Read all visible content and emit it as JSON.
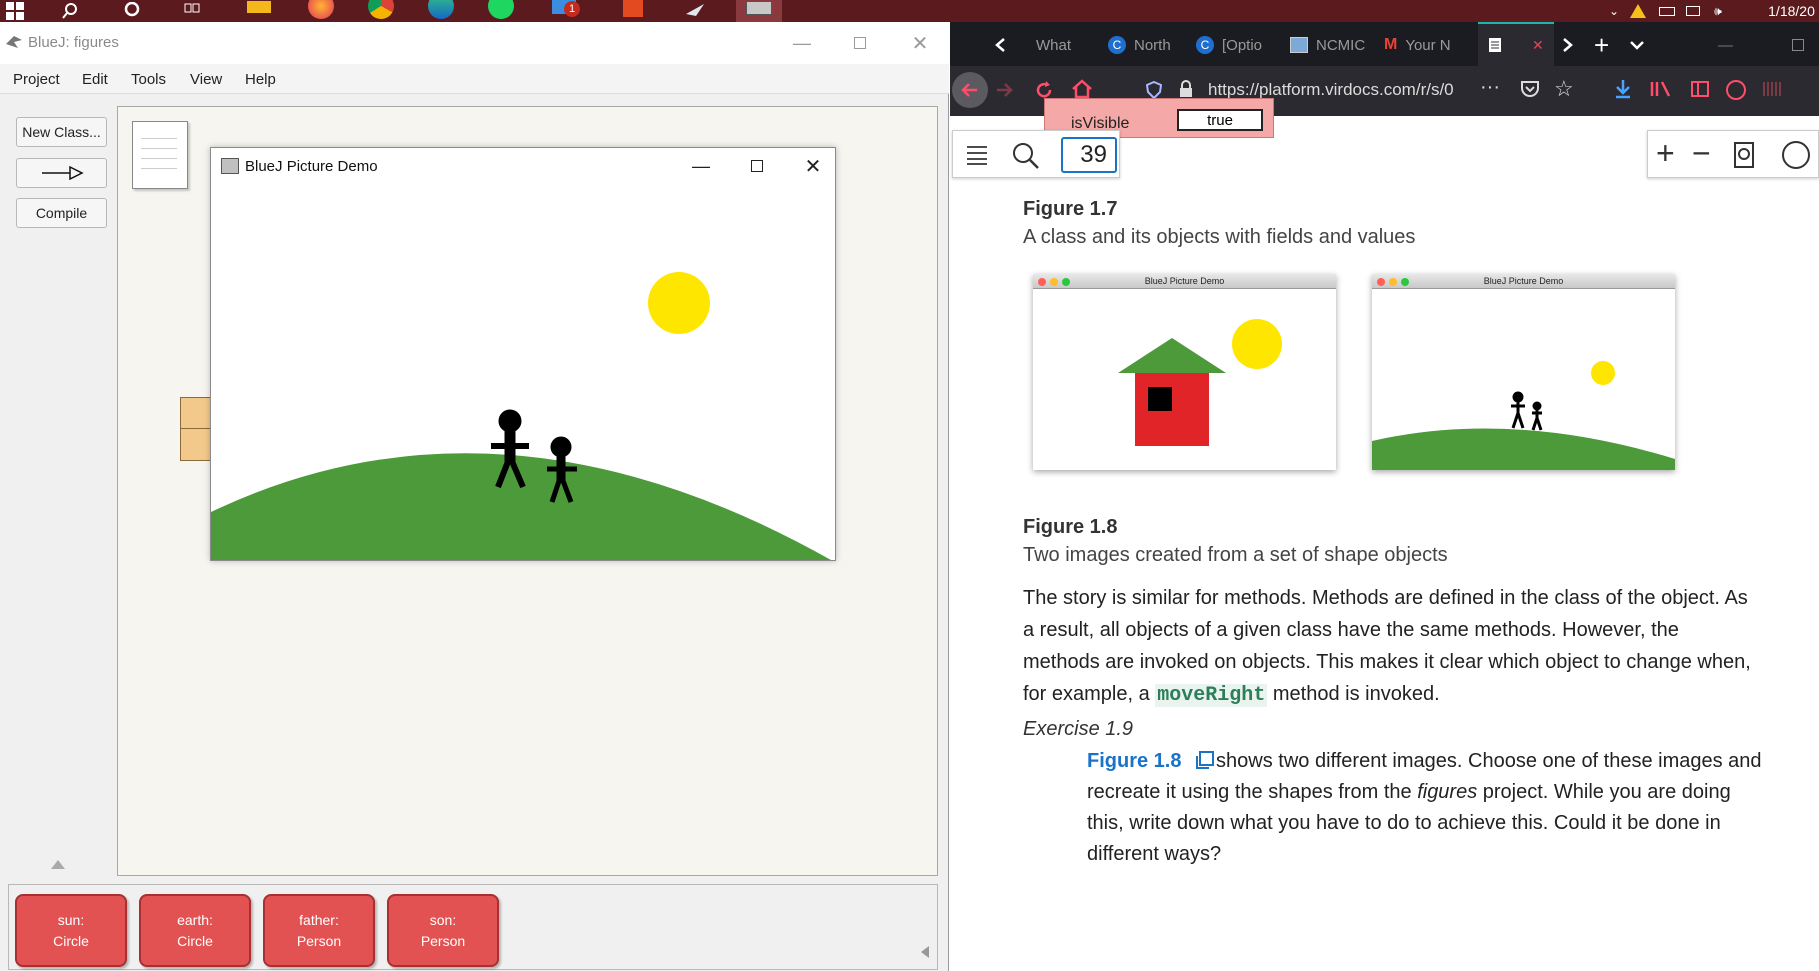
{
  "taskbar": {
    "date": "1/18/20",
    "mail_badge": "1"
  },
  "bluej": {
    "title": "BlueJ:  figures",
    "menu": [
      "Project",
      "Edit",
      "Tools",
      "View",
      "Help"
    ],
    "buttons": {
      "new_class": "New Class...",
      "compile": "Compile"
    },
    "objects": [
      {
        "name": "sun:",
        "type": "Circle"
      },
      {
        "name": "earth:",
        "type": "Circle"
      },
      {
        "name": "father:",
        "type": "Person"
      },
      {
        "name": "son:",
        "type": "Person"
      }
    ],
    "demo_window": {
      "title": "BlueJ Picture Demo"
    }
  },
  "firefox": {
    "tabs": [
      "What",
      "North",
      "[Optio",
      "NCMIC",
      "Your N"
    ],
    "url": "https://platform.virdocs.com/r/s/0",
    "reader": {
      "page_number": "39",
      "snippet_field": "isVisible",
      "snippet_value": "true"
    },
    "figure_1_7": {
      "label": "Figure 1.7",
      "caption": "A class and its objects with fields and values"
    },
    "mini_windows": [
      "BlueJ Picture Demo",
      "BlueJ Picture Demo"
    ],
    "figure_1_8": {
      "label": "Figure 1.8",
      "caption": "Two images created from a set of shape objects"
    },
    "paragraph": {
      "line1": "The story is similar for methods. Methods are defined in the class of the object. As",
      "line2": "a result, all objects of a given class have the same methods. However, the",
      "line3": "methods are invoked on objects. This makes it clear which object to change when,",
      "line4_pre": "for example, a ",
      "line4_code": "moveRight",
      "line4_post": " method is invoked."
    },
    "exercise": {
      "heading": "Exercise 1.9",
      "link": "Figure 1.8",
      "line1_post": "shows two different images. Choose one of these images and",
      "line2_pre": "recreate it using the shapes from the ",
      "line2_em": "figures",
      "line2_post": " project. While you are doing",
      "line3": "this, write down what you have to do to achieve this. Could it be done in",
      "line4": "different ways?"
    }
  },
  "colors": {
    "object_red": "#e35252",
    "sun_yellow": "#ffe600",
    "grass_green": "#4c9a3a",
    "house_red": "#e02428",
    "link_blue": "#1a73c8"
  }
}
